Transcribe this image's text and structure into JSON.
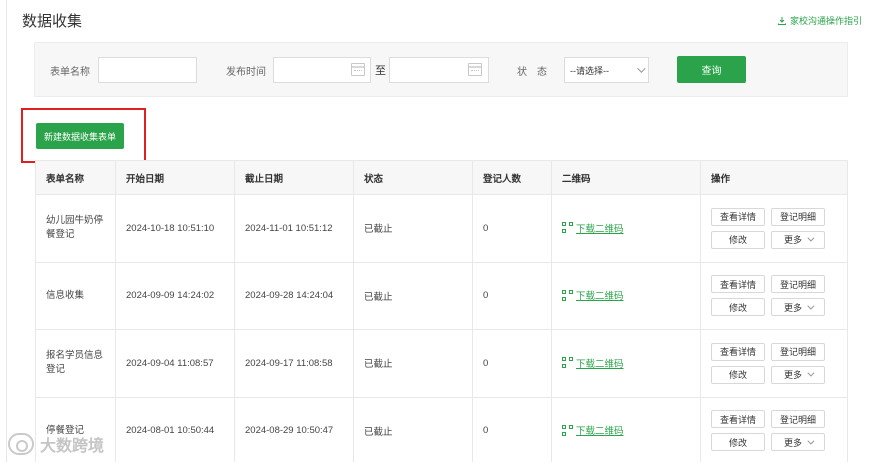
{
  "header": {
    "title": "数据收集",
    "guide_link": "家校沟通操作指引"
  },
  "filter": {
    "form_name_label": "表单名称",
    "form_name_value": "",
    "publish_time_label": "发布时间",
    "date_start_value": "",
    "date_separator": "至",
    "date_end_value": "",
    "status_label": "状　态",
    "status_selected": "--请选择--",
    "query_label": "查询"
  },
  "actions": {
    "new_form_label": "新建数据收集表单"
  },
  "table": {
    "headers": [
      "表单名称",
      "开始日期",
      "截止日期",
      "状态",
      "登记人数",
      "二维码",
      "操作"
    ],
    "qr_label": "下载二维码",
    "op_labels": {
      "view": "查看详情",
      "records": "登记明细",
      "edit": "修改",
      "more": "更多"
    },
    "rows": [
      {
        "name": "幼儿园牛奶停餐登记",
        "start": "2024-10-18 10:51:10",
        "end": "2024-11-01 10:51:12",
        "status": "已截止",
        "count": "0"
      },
      {
        "name": "信息收集",
        "start": "2024-09-09 14:24:02",
        "end": "2024-09-28 14:24:04",
        "status": "已截止",
        "count": "0"
      },
      {
        "name": "报名学员信息登记",
        "start": "2024-09-04 11:08:57",
        "end": "2024-09-17 11:08:58",
        "status": "已截止",
        "count": "0"
      },
      {
        "name": "停餐登记",
        "start": "2024-08-01 10:50:44",
        "end": "2024-08-29 10:50:47",
        "status": "已截止",
        "count": "0"
      }
    ]
  },
  "watermark": {
    "text": "大数跨境"
  },
  "colors": {
    "accent": "#2aa34a",
    "highlight": "#e02020"
  }
}
